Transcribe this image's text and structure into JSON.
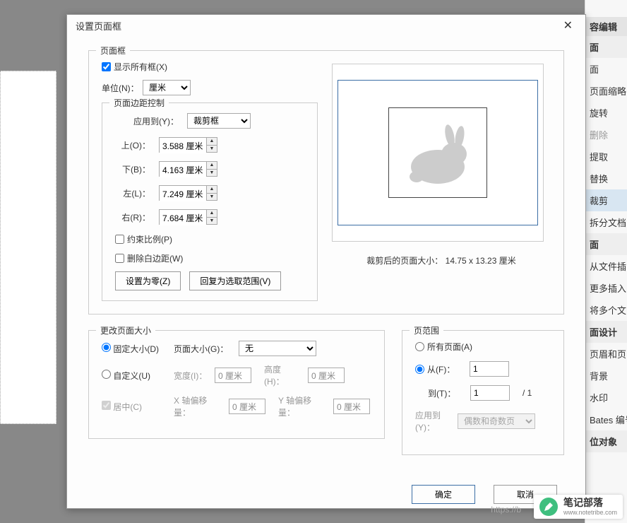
{
  "sidebar": {
    "header": "容编辑",
    "items": [
      {
        "label": "面",
        "type": "header"
      },
      {
        "label": "面"
      },
      {
        "label": "页面缩略"
      },
      {
        "label": "旋转"
      },
      {
        "label": "删除",
        "gray": true
      },
      {
        "label": "提取"
      },
      {
        "label": "替换"
      },
      {
        "label": "裁剪",
        "active": true
      },
      {
        "label": "拆分文档"
      },
      {
        "label": "面",
        "type": "header"
      },
      {
        "label": "从文件插"
      },
      {
        "label": "更多插入"
      },
      {
        "label": "将多个文"
      },
      {
        "label": "面设计",
        "type": "header"
      },
      {
        "label": "页眉和页"
      },
      {
        "label": "背景"
      },
      {
        "label": "水印"
      },
      {
        "label": "Bates 编号"
      },
      {
        "label": "位对象",
        "type": "header"
      }
    ]
  },
  "dialog": {
    "title": "设置页面框",
    "pagebox": {
      "legend": "页面框",
      "show_all": "显示所有框(X)",
      "unit_label": "单位(N)：",
      "unit_value": "厘米",
      "margin": {
        "legend": "页面边距控制",
        "apply_to_label": "应用到(Y)：",
        "apply_to_value": "裁剪框",
        "top_label": "上(O)：",
        "top_value": "3.588 厘米",
        "bottom_label": "下(B)：",
        "bottom_value": "4.163 厘米",
        "left_label": "左(L)：",
        "left_value": "7.249 厘米",
        "right_label": "右(R)：",
        "right_value": "7.684 厘米",
        "constrain": "约束比例(P)",
        "remove_white": "删除白边距(W)",
        "set_zero": "设置为零(Z)",
        "revert": "回复为选取范围(V)"
      },
      "preview_caption_prefix": "裁剪后的页面大小：",
      "preview_size": "14.75 x 13.23 厘米"
    },
    "change_size": {
      "legend": "更改页面大小",
      "fixed": "固定大小(D)",
      "custom": "自定义(U)",
      "center": "居中(C)",
      "page_size_label": "页面大小(G)：",
      "page_size_value": "无",
      "width_label": "宽度(I)：",
      "width_value": "0 厘米",
      "height_label": "高度(H)：",
      "height_value": "0 厘米",
      "xoff_label": "X 轴偏移量：",
      "xoff_value": "0 厘米",
      "yoff_label": "Y 轴偏移量：",
      "yoff_value": "0 厘米"
    },
    "range": {
      "legend": "页范围",
      "all": "所有页面(A)",
      "from_label": "从(F)：",
      "from_value": "1",
      "to_label": "到(T)：",
      "to_value": "1",
      "total": "/ 1",
      "apply_to_label": "应用到(Y)：",
      "apply_to_value": "偶数和奇数页"
    },
    "ok": "确定",
    "cancel": "取消"
  },
  "watermark": {
    "url": "https://b",
    "name": "笔记部落",
    "sub": "www.notetribe.com"
  }
}
